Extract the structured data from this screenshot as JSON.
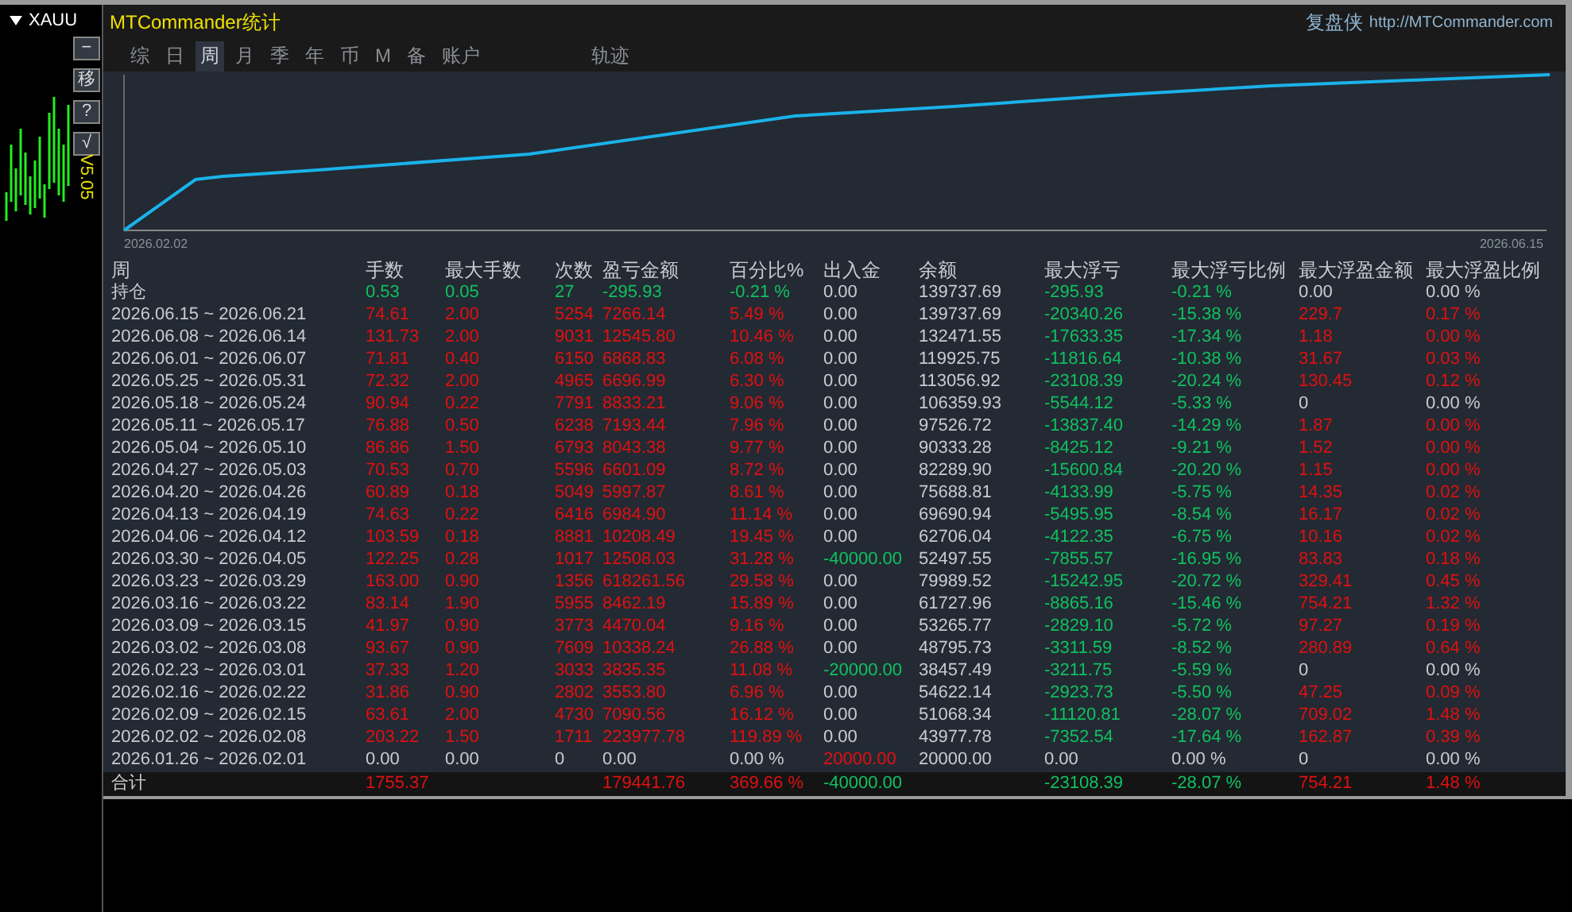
{
  "side_chart": {
    "symbol": "XAUU",
    "buttons": [
      "−",
      "移",
      "?",
      "√"
    ],
    "version": "V5.05"
  },
  "header": {
    "title": "MTCommander统计",
    "brand": "复盘侠",
    "url": "http://MTCommander.com"
  },
  "tabs": [
    {
      "label": "综",
      "selected": false
    },
    {
      "label": "日",
      "selected": false
    },
    {
      "label": "周",
      "selected": true
    },
    {
      "label": "月",
      "selected": false
    },
    {
      "label": "季",
      "selected": false
    },
    {
      "label": "年",
      "selected": false
    },
    {
      "label": "币",
      "selected": false
    },
    {
      "label": "M",
      "selected": false
    },
    {
      "label": "备",
      "selected": false
    },
    {
      "label": "账户",
      "selected": false
    }
  ],
  "trail_tab": {
    "label": "轨迹",
    "selected": false
  },
  "chart": {
    "start_label": "2026.02.02",
    "end_label": "2026.06.15"
  },
  "table": {
    "columns": [
      "周",
      "手数",
      "最大手数",
      "次数",
      "盈亏金额",
      "百分比%",
      "出入金",
      "余额",
      "最大浮亏",
      "最大浮亏比例",
      "最大浮盈金额",
      "最大浮盈比例"
    ],
    "rows": [
      [
        {
          "text": "持仓",
          "color": "#c8ccd0"
        },
        {
          "text": "0.53",
          "color": "#10c060"
        },
        {
          "text": "0.05",
          "color": "#10c060"
        },
        {
          "text": "27",
          "color": "#10c060"
        },
        {
          "text": "-295.93",
          "color": "#10c060"
        },
        {
          "text": "-0.21 %",
          "color": "#10c060"
        },
        {
          "text": "0.00",
          "color": "#c8ccd0"
        },
        {
          "text": "139737.69",
          "color": "#c8ccd0"
        },
        {
          "text": "-295.93",
          "color": "#10c060"
        },
        {
          "text": "-0.21 %",
          "color": "#10c060"
        },
        {
          "text": "0.00",
          "color": "#c8ccd0"
        },
        {
          "text": "0.00 %",
          "color": "#c8ccd0"
        }
      ],
      [
        {
          "text": "2026.06.15 ~ 2026.06.21",
          "color": "#c8ccd0"
        },
        {
          "text": "74.61",
          "color": "#e01010"
        },
        {
          "text": "2.00",
          "color": "#e01010"
        },
        {
          "text": "5254",
          "color": "#e01010"
        },
        {
          "text": "7266.14",
          "color": "#e01010"
        },
        {
          "text": "5.49 %",
          "color": "#e01010"
        },
        {
          "text": "0.00",
          "color": "#c8ccd0"
        },
        {
          "text": "139737.69",
          "color": "#c8ccd0"
        },
        {
          "text": "-20340.26",
          "color": "#10c060"
        },
        {
          "text": "-15.38 %",
          "color": "#10c060"
        },
        {
          "text": "229.7",
          "color": "#e01010"
        },
        {
          "text": "0.17 %",
          "color": "#e01010"
        }
      ],
      [
        {
          "text": "2026.06.08 ~ 2026.06.14",
          "color": "#c8ccd0"
        },
        {
          "text": "131.73",
          "color": "#e01010"
        },
        {
          "text": "2.00",
          "color": "#e01010"
        },
        {
          "text": "9031",
          "color": "#e01010"
        },
        {
          "text": "12545.80",
          "color": "#e01010"
        },
        {
          "text": "10.46 %",
          "color": "#e01010"
        },
        {
          "text": "0.00",
          "color": "#c8ccd0"
        },
        {
          "text": "132471.55",
          "color": "#c8ccd0"
        },
        {
          "text": "-17633.35",
          "color": "#10c060"
        },
        {
          "text": "-17.34 %",
          "color": "#10c060"
        },
        {
          "text": "1.18",
          "color": "#e01010"
        },
        {
          "text": "0.00 %",
          "color": "#e01010"
        }
      ],
      [
        {
          "text": "2026.06.01 ~ 2026.06.07",
          "color": "#c8ccd0"
        },
        {
          "text": "71.81",
          "color": "#e01010"
        },
        {
          "text": "0.40",
          "color": "#e01010"
        },
        {
          "text": "6150",
          "color": "#e01010"
        },
        {
          "text": "6868.83",
          "color": "#e01010"
        },
        {
          "text": "6.08 %",
          "color": "#e01010"
        },
        {
          "text": "0.00",
          "color": "#c8ccd0"
        },
        {
          "text": "119925.75",
          "color": "#c8ccd0"
        },
        {
          "text": "-11816.64",
          "color": "#10c060"
        },
        {
          "text": "-10.38 %",
          "color": "#10c060"
        },
        {
          "text": "31.67",
          "color": "#e01010"
        },
        {
          "text": "0.03 %",
          "color": "#e01010"
        }
      ],
      [
        {
          "text": "2026.05.25 ~ 2026.05.31",
          "color": "#c8ccd0"
        },
        {
          "text": "72.32",
          "color": "#e01010"
        },
        {
          "text": "2.00",
          "color": "#e01010"
        },
        {
          "text": "4965",
          "color": "#e01010"
        },
        {
          "text": "6696.99",
          "color": "#e01010"
        },
        {
          "text": "6.30 %",
          "color": "#e01010"
        },
        {
          "text": "0.00",
          "color": "#c8ccd0"
        },
        {
          "text": "113056.92",
          "color": "#c8ccd0"
        },
        {
          "text": "-23108.39",
          "color": "#10c060"
        },
        {
          "text": "-20.24 %",
          "color": "#10c060"
        },
        {
          "text": "130.45",
          "color": "#e01010"
        },
        {
          "text": "0.12 %",
          "color": "#e01010"
        }
      ],
      [
        {
          "text": "2026.05.18 ~ 2026.05.24",
          "color": "#c8ccd0"
        },
        {
          "text": "90.94",
          "color": "#e01010"
        },
        {
          "text": "0.22",
          "color": "#e01010"
        },
        {
          "text": "7791",
          "color": "#e01010"
        },
        {
          "text": "8833.21",
          "color": "#e01010"
        },
        {
          "text": "9.06 %",
          "color": "#e01010"
        },
        {
          "text": "0.00",
          "color": "#c8ccd0"
        },
        {
          "text": "106359.93",
          "color": "#c8ccd0"
        },
        {
          "text": "-5544.12",
          "color": "#10c060"
        },
        {
          "text": "-5.33 %",
          "color": "#10c060"
        },
        {
          "text": "0",
          "color": "#c8ccd0"
        },
        {
          "text": "0.00 %",
          "color": "#c8ccd0"
        }
      ],
      [
        {
          "text": "2026.05.11 ~ 2026.05.17",
          "color": "#c8ccd0"
        },
        {
          "text": "76.88",
          "color": "#e01010"
        },
        {
          "text": "0.50",
          "color": "#e01010"
        },
        {
          "text": "6238",
          "color": "#e01010"
        },
        {
          "text": "7193.44",
          "color": "#e01010"
        },
        {
          "text": "7.96 %",
          "color": "#e01010"
        },
        {
          "text": "0.00",
          "color": "#c8ccd0"
        },
        {
          "text": "97526.72",
          "color": "#c8ccd0"
        },
        {
          "text": "-13837.40",
          "color": "#10c060"
        },
        {
          "text": "-14.29 %",
          "color": "#10c060"
        },
        {
          "text": "1.87",
          "color": "#e01010"
        },
        {
          "text": "0.00 %",
          "color": "#e01010"
        }
      ],
      [
        {
          "text": "2026.05.04 ~ 2026.05.10",
          "color": "#c8ccd0"
        },
        {
          "text": "86.86",
          "color": "#e01010"
        },
        {
          "text": "1.50",
          "color": "#e01010"
        },
        {
          "text": "6793",
          "color": "#e01010"
        },
        {
          "text": "8043.38",
          "color": "#e01010"
        },
        {
          "text": "9.77 %",
          "color": "#e01010"
        },
        {
          "text": "0.00",
          "color": "#c8ccd0"
        },
        {
          "text": "90333.28",
          "color": "#c8ccd0"
        },
        {
          "text": "-8425.12",
          "color": "#10c060"
        },
        {
          "text": "-9.21 %",
          "color": "#10c060"
        },
        {
          "text": "1.52",
          "color": "#e01010"
        },
        {
          "text": "0.00 %",
          "color": "#e01010"
        }
      ],
      [
        {
          "text": "2026.04.27 ~ 2026.05.03",
          "color": "#c8ccd0"
        },
        {
          "text": "70.53",
          "color": "#e01010"
        },
        {
          "text": "0.70",
          "color": "#e01010"
        },
        {
          "text": "5596",
          "color": "#e01010"
        },
        {
          "text": "6601.09",
          "color": "#e01010"
        },
        {
          "text": "8.72 %",
          "color": "#e01010"
        },
        {
          "text": "0.00",
          "color": "#c8ccd0"
        },
        {
          "text": "82289.90",
          "color": "#c8ccd0"
        },
        {
          "text": "-15600.84",
          "color": "#10c060"
        },
        {
          "text": "-20.20 %",
          "color": "#10c060"
        },
        {
          "text": "1.15",
          "color": "#e01010"
        },
        {
          "text": "0.00 %",
          "color": "#e01010"
        }
      ],
      [
        {
          "text": "2026.04.20 ~ 2026.04.26",
          "color": "#c8ccd0"
        },
        {
          "text": "60.89",
          "color": "#e01010"
        },
        {
          "text": "0.18",
          "color": "#e01010"
        },
        {
          "text": "5049",
          "color": "#e01010"
        },
        {
          "text": "5997.87",
          "color": "#e01010"
        },
        {
          "text": "8.61 %",
          "color": "#e01010"
        },
        {
          "text": "0.00",
          "color": "#c8ccd0"
        },
        {
          "text": "75688.81",
          "color": "#c8ccd0"
        },
        {
          "text": "-4133.99",
          "color": "#10c060"
        },
        {
          "text": "-5.75 %",
          "color": "#10c060"
        },
        {
          "text": "14.35",
          "color": "#e01010"
        },
        {
          "text": "0.02 %",
          "color": "#e01010"
        }
      ],
      [
        {
          "text": "2026.04.13 ~ 2026.04.19",
          "color": "#c8ccd0"
        },
        {
          "text": "74.63",
          "color": "#e01010"
        },
        {
          "text": "0.22",
          "color": "#e01010"
        },
        {
          "text": "6416",
          "color": "#e01010"
        },
        {
          "text": "6984.90",
          "color": "#e01010"
        },
        {
          "text": "11.14 %",
          "color": "#e01010"
        },
        {
          "text": "0.00",
          "color": "#c8ccd0"
        },
        {
          "text": "69690.94",
          "color": "#c8ccd0"
        },
        {
          "text": "-5495.95",
          "color": "#10c060"
        },
        {
          "text": "-8.54 %",
          "color": "#10c060"
        },
        {
          "text": "16.17",
          "color": "#e01010"
        },
        {
          "text": "0.02 %",
          "color": "#e01010"
        }
      ],
      [
        {
          "text": "2026.04.06 ~ 2026.04.12",
          "color": "#c8ccd0"
        },
        {
          "text": "103.59",
          "color": "#e01010"
        },
        {
          "text": "0.18",
          "color": "#e01010"
        },
        {
          "text": "8881",
          "color": "#e01010"
        },
        {
          "text": "10208.49",
          "color": "#e01010"
        },
        {
          "text": "19.45 %",
          "color": "#e01010"
        },
        {
          "text": "0.00",
          "color": "#c8ccd0"
        },
        {
          "text": "62706.04",
          "color": "#c8ccd0"
        },
        {
          "text": "-4122.35",
          "color": "#10c060"
        },
        {
          "text": "-6.75 %",
          "color": "#10c060"
        },
        {
          "text": "10.16",
          "color": "#e01010"
        },
        {
          "text": "0.02 %",
          "color": "#e01010"
        }
      ],
      [
        {
          "text": "2026.03.30 ~ 2026.04.05",
          "color": "#c8ccd0"
        },
        {
          "text": "122.25",
          "color": "#e01010"
        },
        {
          "text": "0.28",
          "color": "#e01010"
        },
        {
          "text": "1017",
          "color": "#e01010"
        },
        {
          "text": "12508.03",
          "color": "#e01010"
        },
        {
          "text": "31.28 %",
          "color": "#e01010"
        },
        {
          "text": "-40000.00",
          "color": "#10c060"
        },
        {
          "text": "52497.55",
          "color": "#c8ccd0"
        },
        {
          "text": "-7855.57",
          "color": "#10c060"
        },
        {
          "text": "-16.95 %",
          "color": "#10c060"
        },
        {
          "text": "83.83",
          "color": "#e01010"
        },
        {
          "text": "0.18 %",
          "color": "#e01010"
        }
      ],
      [
        {
          "text": "2026.03.23 ~ 2026.03.29",
          "color": "#c8ccd0"
        },
        {
          "text": "163.00",
          "color": "#e01010"
        },
        {
          "text": "0.90",
          "color": "#e01010"
        },
        {
          "text": "1356",
          "color": "#e01010"
        },
        {
          "text": "618261.56",
          "color": "#e01010"
        },
        {
          "text": "29.58 %",
          "color": "#e01010"
        },
        {
          "text": "0.00",
          "color": "#c8ccd0"
        },
        {
          "text": "79989.52",
          "color": "#c8ccd0"
        },
        {
          "text": "-15242.95",
          "color": "#10c060"
        },
        {
          "text": "-20.72 %",
          "color": "#10c060"
        },
        {
          "text": "329.41",
          "color": "#e01010"
        },
        {
          "text": "0.45 %",
          "color": "#e01010"
        }
      ],
      [
        {
          "text": "2026.03.16 ~ 2026.03.22",
          "color": "#c8ccd0"
        },
        {
          "text": "83.14",
          "color": "#e01010"
        },
        {
          "text": "1.90",
          "color": "#e01010"
        },
        {
          "text": "5955",
          "color": "#e01010"
        },
        {
          "text": "8462.19",
          "color": "#e01010"
        },
        {
          "text": "15.89 %",
          "color": "#e01010"
        },
        {
          "text": "0.00",
          "color": "#c8ccd0"
        },
        {
          "text": "61727.96",
          "color": "#c8ccd0"
        },
        {
          "text": "-8865.16",
          "color": "#10c060"
        },
        {
          "text": "-15.46 %",
          "color": "#10c060"
        },
        {
          "text": "754.21",
          "color": "#e01010"
        },
        {
          "text": "1.32 %",
          "color": "#e01010"
        }
      ],
      [
        {
          "text": "2026.03.09 ~ 2026.03.15",
          "color": "#c8ccd0"
        },
        {
          "text": "41.97",
          "color": "#e01010"
        },
        {
          "text": "0.90",
          "color": "#e01010"
        },
        {
          "text": "3773",
          "color": "#e01010"
        },
        {
          "text": "4470.04",
          "color": "#e01010"
        },
        {
          "text": "9.16 %",
          "color": "#e01010"
        },
        {
          "text": "0.00",
          "color": "#c8ccd0"
        },
        {
          "text": "53265.77",
          "color": "#c8ccd0"
        },
        {
          "text": "-2829.10",
          "color": "#10c060"
        },
        {
          "text": "-5.72 %",
          "color": "#10c060"
        },
        {
          "text": "97.27",
          "color": "#e01010"
        },
        {
          "text": "0.19 %",
          "color": "#e01010"
        }
      ],
      [
        {
          "text": "2026.03.02 ~ 2026.03.08",
          "color": "#c8ccd0"
        },
        {
          "text": "93.67",
          "color": "#e01010"
        },
        {
          "text": "0.90",
          "color": "#e01010"
        },
        {
          "text": "7609",
          "color": "#e01010"
        },
        {
          "text": "10338.24",
          "color": "#e01010"
        },
        {
          "text": "26.88 %",
          "color": "#e01010"
        },
        {
          "text": "0.00",
          "color": "#c8ccd0"
        },
        {
          "text": "48795.73",
          "color": "#c8ccd0"
        },
        {
          "text": "-3311.59",
          "color": "#10c060"
        },
        {
          "text": "-8.52 %",
          "color": "#10c060"
        },
        {
          "text": "280.89",
          "color": "#e01010"
        },
        {
          "text": "0.64 %",
          "color": "#e01010"
        }
      ],
      [
        {
          "text": "2026.02.23 ~ 2026.03.01",
          "color": "#c8ccd0"
        },
        {
          "text": "37.33",
          "color": "#e01010"
        },
        {
          "text": "1.20",
          "color": "#e01010"
        },
        {
          "text": "3033",
          "color": "#e01010"
        },
        {
          "text": "3835.35",
          "color": "#e01010"
        },
        {
          "text": "11.08 %",
          "color": "#e01010"
        },
        {
          "text": "-20000.00",
          "color": "#10c060"
        },
        {
          "text": "38457.49",
          "color": "#c8ccd0"
        },
        {
          "text": "-3211.75",
          "color": "#10c060"
        },
        {
          "text": "-5.59 %",
          "color": "#10c060"
        },
        {
          "text": "0",
          "color": "#c8ccd0"
        },
        {
          "text": "0.00 %",
          "color": "#c8ccd0"
        }
      ],
      [
        {
          "text": "2026.02.16 ~ 2026.02.22",
          "color": "#c8ccd0"
        },
        {
          "text": "31.86",
          "color": "#e01010"
        },
        {
          "text": "0.90",
          "color": "#e01010"
        },
        {
          "text": "2802",
          "color": "#e01010"
        },
        {
          "text": "3553.80",
          "color": "#e01010"
        },
        {
          "text": "6.96 %",
          "color": "#e01010"
        },
        {
          "text": "0.00",
          "color": "#c8ccd0"
        },
        {
          "text": "54622.14",
          "color": "#c8ccd0"
        },
        {
          "text": "-2923.73",
          "color": "#10c060"
        },
        {
          "text": "-5.50 %",
          "color": "#10c060"
        },
        {
          "text": "47.25",
          "color": "#e01010"
        },
        {
          "text": "0.09 %",
          "color": "#e01010"
        }
      ],
      [
        {
          "text": "2026.02.09 ~ 2026.02.15",
          "color": "#c8ccd0"
        },
        {
          "text": "63.61",
          "color": "#e01010"
        },
        {
          "text": "2.00",
          "color": "#e01010"
        },
        {
          "text": "4730",
          "color": "#e01010"
        },
        {
          "text": "7090.56",
          "color": "#e01010"
        },
        {
          "text": "16.12 %",
          "color": "#e01010"
        },
        {
          "text": "0.00",
          "color": "#c8ccd0"
        },
        {
          "text": "51068.34",
          "color": "#c8ccd0"
        },
        {
          "text": "-11120.81",
          "color": "#10c060"
        },
        {
          "text": "-28.07 %",
          "color": "#10c060"
        },
        {
          "text": "709.02",
          "color": "#e01010"
        },
        {
          "text": "1.48 %",
          "color": "#e01010"
        }
      ],
      [
        {
          "text": "2026.02.02 ~ 2026.02.08",
          "color": "#c8ccd0"
        },
        {
          "text": "203.22",
          "color": "#e01010"
        },
        {
          "text": "1.50",
          "color": "#e01010"
        },
        {
          "text": "1711",
          "color": "#e01010"
        },
        {
          "text": "223977.78",
          "color": "#e01010"
        },
        {
          "text": "119.89 %",
          "color": "#e01010"
        },
        {
          "text": "0.00",
          "color": "#c8ccd0"
        },
        {
          "text": "43977.78",
          "color": "#c8ccd0"
        },
        {
          "text": "-7352.54",
          "color": "#10c060"
        },
        {
          "text": "-17.64 %",
          "color": "#10c060"
        },
        {
          "text": "162.87",
          "color": "#e01010"
        },
        {
          "text": "0.39 %",
          "color": "#e01010"
        }
      ],
      [
        {
          "text": "2026.01.26 ~ 2026.02.01",
          "color": "#c8ccd0"
        },
        {
          "text": "0.00",
          "color": "#c8ccd0"
        },
        {
          "text": "0.00",
          "color": "#c8ccd0"
        },
        {
          "text": "0",
          "color": "#c8ccd0"
        },
        {
          "text": "0.00",
          "color": "#c8ccd0"
        },
        {
          "text": "0.00 %",
          "color": "#c8ccd0"
        },
        {
          "text": "20000.00",
          "color": "#e01010"
        },
        {
          "text": "20000.00",
          "color": "#c8ccd0"
        },
        {
          "text": "0.00",
          "color": "#c8ccd0"
        },
        {
          "text": "0.00 %",
          "color": "#c8ccd0"
        },
        {
          "text": "0",
          "color": "#c8ccd0"
        },
        {
          "text": "0.00 %",
          "color": "#c8ccd0"
        }
      ]
    ],
    "total": {
      "label": {
        "text": "合计",
        "color": "#c8ccd0"
      },
      "lots": {
        "text": "1755.37",
        "color": "#e01010"
      },
      "profit": {
        "text": "179441.76",
        "color": "#e01010"
      },
      "percent": {
        "text": "369.66 %",
        "color": "#e01010"
      },
      "deposit": {
        "text": "-40000.00",
        "color": "#10c060"
      },
      "max_loss": {
        "text": "-23108.39",
        "color": "#10c060"
      },
      "max_loss_ratio": {
        "text": "-28.07 %",
        "color": "#10c060"
      },
      "max_gain": {
        "text": "754.21",
        "color": "#e01010"
      },
      "max_gain_ratio": {
        "text": "1.48 %",
        "color": "#e01010"
      }
    }
  }
}
